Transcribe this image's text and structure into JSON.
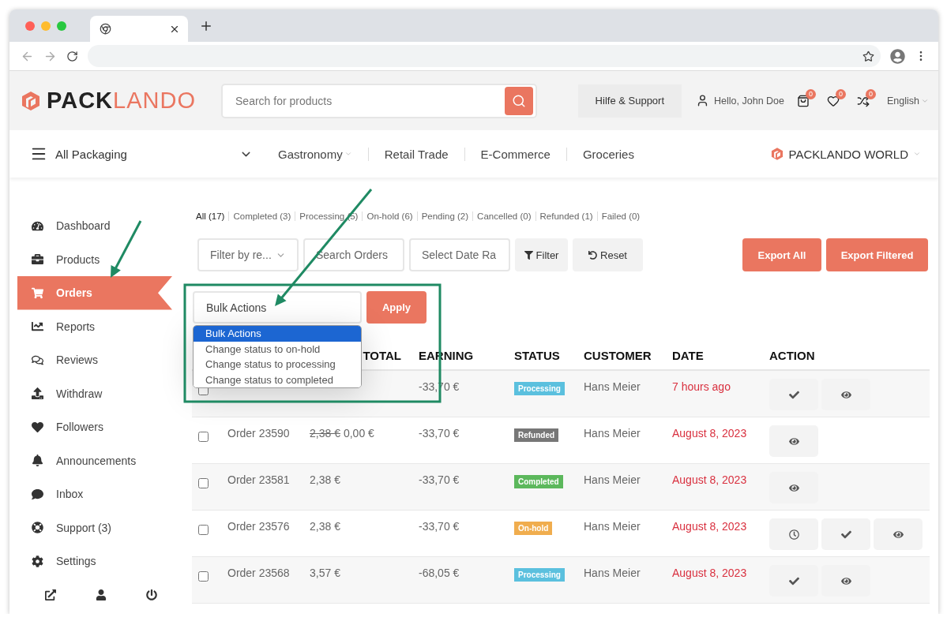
{
  "header": {
    "logo": {
      "dark": "PACK",
      "accent": "LANDO"
    },
    "search": {
      "placeholder": "Search for products"
    },
    "help": "Hilfe & Support",
    "greeting": "Hello, John Doe",
    "cart_count": "0",
    "wishlist_count": "0",
    "compare_count": "0",
    "language": "English"
  },
  "nav": {
    "menu_label": "All Packaging",
    "links": [
      {
        "label": "Gastronomy",
        "dropdown": true
      },
      {
        "label": "Retail Trade",
        "dropdown": false
      },
      {
        "label": "E-Commerce",
        "dropdown": false
      },
      {
        "label": "Groceries",
        "dropdown": false
      }
    ],
    "world": "PACKLANDO WORLD"
  },
  "sidebar": {
    "items": [
      {
        "label": "Dashboard",
        "kind": "dashboard",
        "selected": false
      },
      {
        "label": "Products",
        "kind": "products",
        "selected": false
      },
      {
        "label": "Orders",
        "kind": "orders",
        "selected": true
      },
      {
        "label": "Reports",
        "kind": "reports",
        "selected": false
      },
      {
        "label": "Reviews",
        "kind": "reviews",
        "selected": false
      },
      {
        "label": "Withdraw",
        "kind": "withdraw",
        "selected": false
      },
      {
        "label": "Followers",
        "kind": "followers",
        "selected": false
      },
      {
        "label": "Announcements",
        "kind": "announcements",
        "selected": false
      },
      {
        "label": "Inbox",
        "kind": "inbox",
        "selected": false
      },
      {
        "label": "Support (3)",
        "kind": "support",
        "selected": false
      },
      {
        "label": "Settings",
        "kind": "settings",
        "selected": false
      }
    ]
  },
  "status_filters": [
    {
      "label": "All (17)",
      "selected": true
    },
    {
      "label": "Completed (3)",
      "selected": false
    },
    {
      "label": "Processing (5)",
      "selected": false
    },
    {
      "label": "On-hold (6)",
      "selected": false
    },
    {
      "label": "Pending (2)",
      "selected": false
    },
    {
      "label": "Cancelled (0)",
      "selected": false
    },
    {
      "label": "Refunded (1)",
      "selected": false
    },
    {
      "label": "Failed (0)",
      "selected": false
    }
  ],
  "filters": {
    "reseller": "Filter by re...",
    "search_orders": {
      "placeholder": "Search Orders"
    },
    "date_range": {
      "placeholder": "Select Date Ra"
    },
    "filter": "Filter",
    "reset": "Reset",
    "export_all": "Export All",
    "export_filtered": "Export Filtered"
  },
  "bulk": {
    "value": "Bulk Actions",
    "apply": "Apply",
    "expanded": true,
    "options": [
      {
        "label": "Bulk Actions",
        "selected": true
      },
      {
        "label": "Change status to on-hold",
        "selected": false
      },
      {
        "label": "Change status to processing",
        "selected": false
      },
      {
        "label": "Change status to completed",
        "selected": false
      }
    ]
  },
  "table": {
    "columns": [
      "TOTAL",
      "EARNING",
      "STATUS",
      "CUSTOMER",
      "DATE",
      "ACTION"
    ],
    "rows": [
      {
        "checked": false,
        "earning": "-33,70 €",
        "status": {
          "label": "Processing",
          "color": "#5bc0de"
        },
        "customer": "Hans Meier",
        "date": "7 hours ago",
        "actions": [
          {
            "kind": "complete"
          },
          {
            "kind": "view"
          }
        ]
      },
      {
        "checked": false,
        "order": "Order 23590",
        "total_old": "2,38 €",
        "total": "0,00 €",
        "earning": "-33,70 €",
        "status": {
          "label": "Refunded",
          "color": "#777777"
        },
        "customer": "Hans Meier",
        "date": "August 8, 2023",
        "actions": [
          {
            "kind": "view"
          }
        ]
      },
      {
        "checked": false,
        "order": "Order 23581",
        "total": "2,38 €",
        "earning": "-33,70 €",
        "status": {
          "label": "Completed",
          "color": "#5cb85c"
        },
        "customer": "Hans Meier",
        "date": "August 8, 2023",
        "actions": [
          {
            "kind": "view"
          }
        ]
      },
      {
        "checked": false,
        "order": "Order 23576",
        "total": "2,38 €",
        "earning": "-33,70 €",
        "status": {
          "label": "On-hold",
          "color": "#f0ad4e"
        },
        "customer": "Hans Meier",
        "date": "August 8, 2023",
        "actions": [
          {
            "kind": "pending"
          },
          {
            "kind": "complete"
          },
          {
            "kind": "view"
          }
        ]
      },
      {
        "checked": false,
        "order": "Order 23568",
        "total": "3,57 €",
        "earning": "-68,05 €",
        "status": {
          "label": "Processing",
          "color": "#5bc0de"
        },
        "customer": "Hans Meier",
        "date": "August 8, 2023",
        "actions": [
          {
            "kind": "complete"
          },
          {
            "kind": "view"
          }
        ]
      }
    ]
  }
}
